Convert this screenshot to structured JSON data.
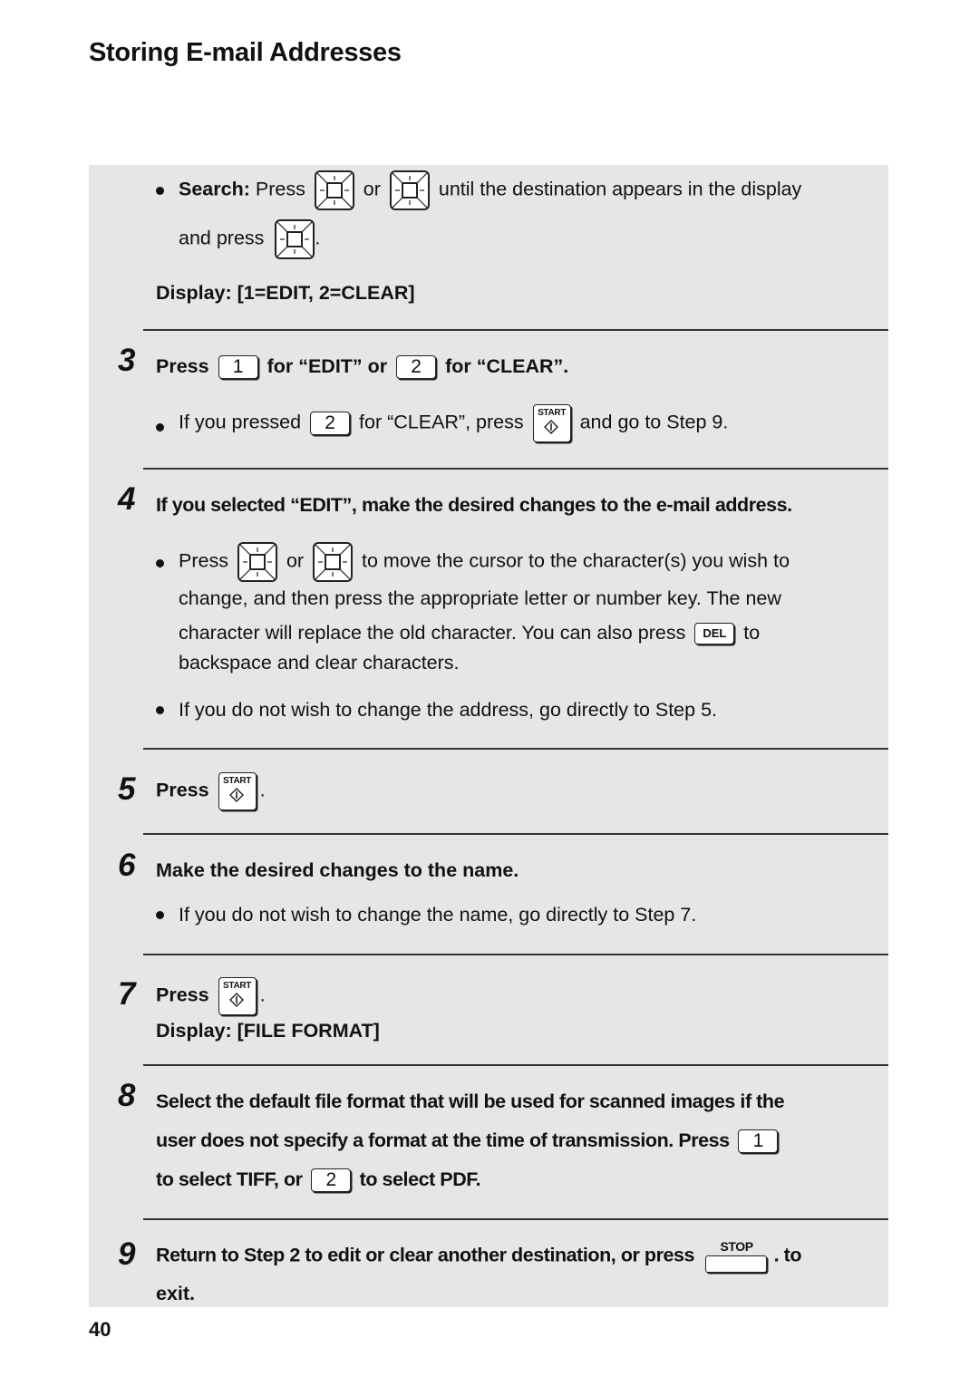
{
  "title": "Storing E-mail Addresses",
  "page_number": "40",
  "search": {
    "label": "Search:",
    "press": "Press",
    "or": "or",
    "rest": "until the destination appears in the display",
    "and_press": "and press",
    "period": "."
  },
  "display1": "Display: [1=EDIT, 2=CLEAR]",
  "keys": {
    "one": "1",
    "two": "2",
    "del": "DEL",
    "start": "START",
    "stop": "STOP"
  },
  "icons": {
    "nav_up": "nav-key-up",
    "nav_down": "nav-key-down",
    "nav_left": "nav-key-left",
    "nav_right": "nav-key-right",
    "start": "start-key",
    "stop": "stop-key"
  },
  "steps": {
    "s3": {
      "number": "3",
      "press": "Press",
      "mid": "for “EDIT” or",
      "end": "for  “CLEAR”.",
      "bullet_a": "If you pressed",
      "bullet_b": "for “CLEAR”, press",
      "bullet_c": "and go to Step 9."
    },
    "s4": {
      "number": "4",
      "heading": "If you selected “EDIT”, make the desired changes to the e-mail address.",
      "b1_press": "Press",
      "b1_or": "or",
      "b1_rest": "to move the cursor to the character(s) you wish to",
      "b1_line2": "change, and then press the appropriate letter or number key. The new",
      "b1_line3a": "character will replace the old character. You can also press",
      "b1_line3b": "to",
      "b1_line4": "backspace and clear characters.",
      "b2": "If you do not wish to change the address, go directly to Step 5."
    },
    "s5": {
      "number": "5",
      "press": "Press",
      "period": "."
    },
    "s6": {
      "number": "6",
      "heading": "Make the desired changes to the name.",
      "bullet": "If you do not wish to change the name, go directly to Step 7."
    },
    "s7": {
      "number": "7",
      "press": "Press",
      "period": ".",
      "display": "Display: [FILE FORMAT]"
    },
    "s8": {
      "number": "8",
      "line1": "Select the default file format that will be used for scanned images if the",
      "line2": "user does not specify a format at the time of transmission. Press",
      "line3a": "to select TIFF, or",
      "line3b": "to select PDF."
    },
    "s9": {
      "number": "9",
      "line1": "Return to Step 2 to edit or clear another destination, or press",
      "line1_end": ". to",
      "line2": "exit."
    }
  }
}
